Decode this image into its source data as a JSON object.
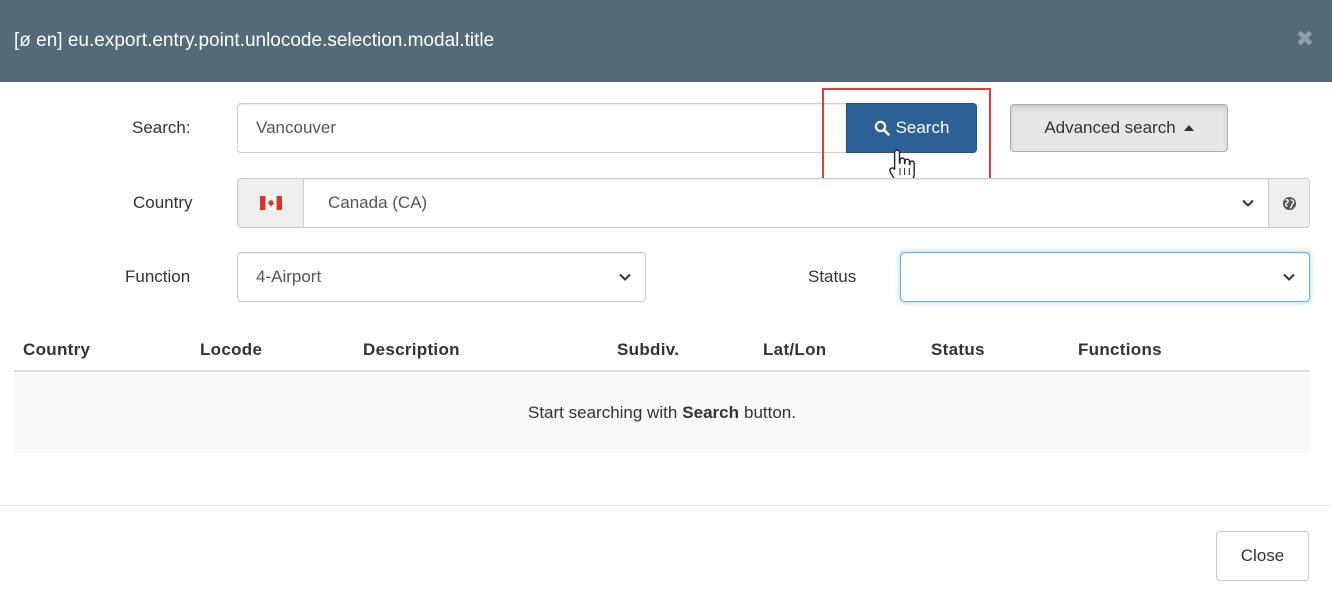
{
  "modal": {
    "title": "[ø en] eu.export.entry.point.unlocode.selection.modal.title",
    "close_glyph": "✖"
  },
  "search": {
    "label": "Search:",
    "value": "Vancouver",
    "button_label": "Search",
    "advanced_label": "Advanced search"
  },
  "country": {
    "label": "Country",
    "selected": "Canada (CA)",
    "flag_icon": "canada-flag-icon",
    "flag_colors": {
      "red": "#e0322a",
      "white": "#ffffff"
    },
    "addon_icon": "globe-icon"
  },
  "function": {
    "label": "Function",
    "selected": "4-Airport"
  },
  "status": {
    "label": "Status",
    "selected": ""
  },
  "table": {
    "columns": [
      "Country",
      "Locode",
      "Description",
      "Subdiv.",
      "Lat/Lon",
      "Status",
      "Functions"
    ],
    "empty_prefix": "Start searching with",
    "empty_bold": "Search",
    "empty_suffix": "button."
  },
  "footer": {
    "close_label": "Close"
  },
  "colors": {
    "header_bg": "#536a78",
    "primary_btn": "#2c6197",
    "highlight": "#e03c3c",
    "focus_border": "#66afe9"
  }
}
